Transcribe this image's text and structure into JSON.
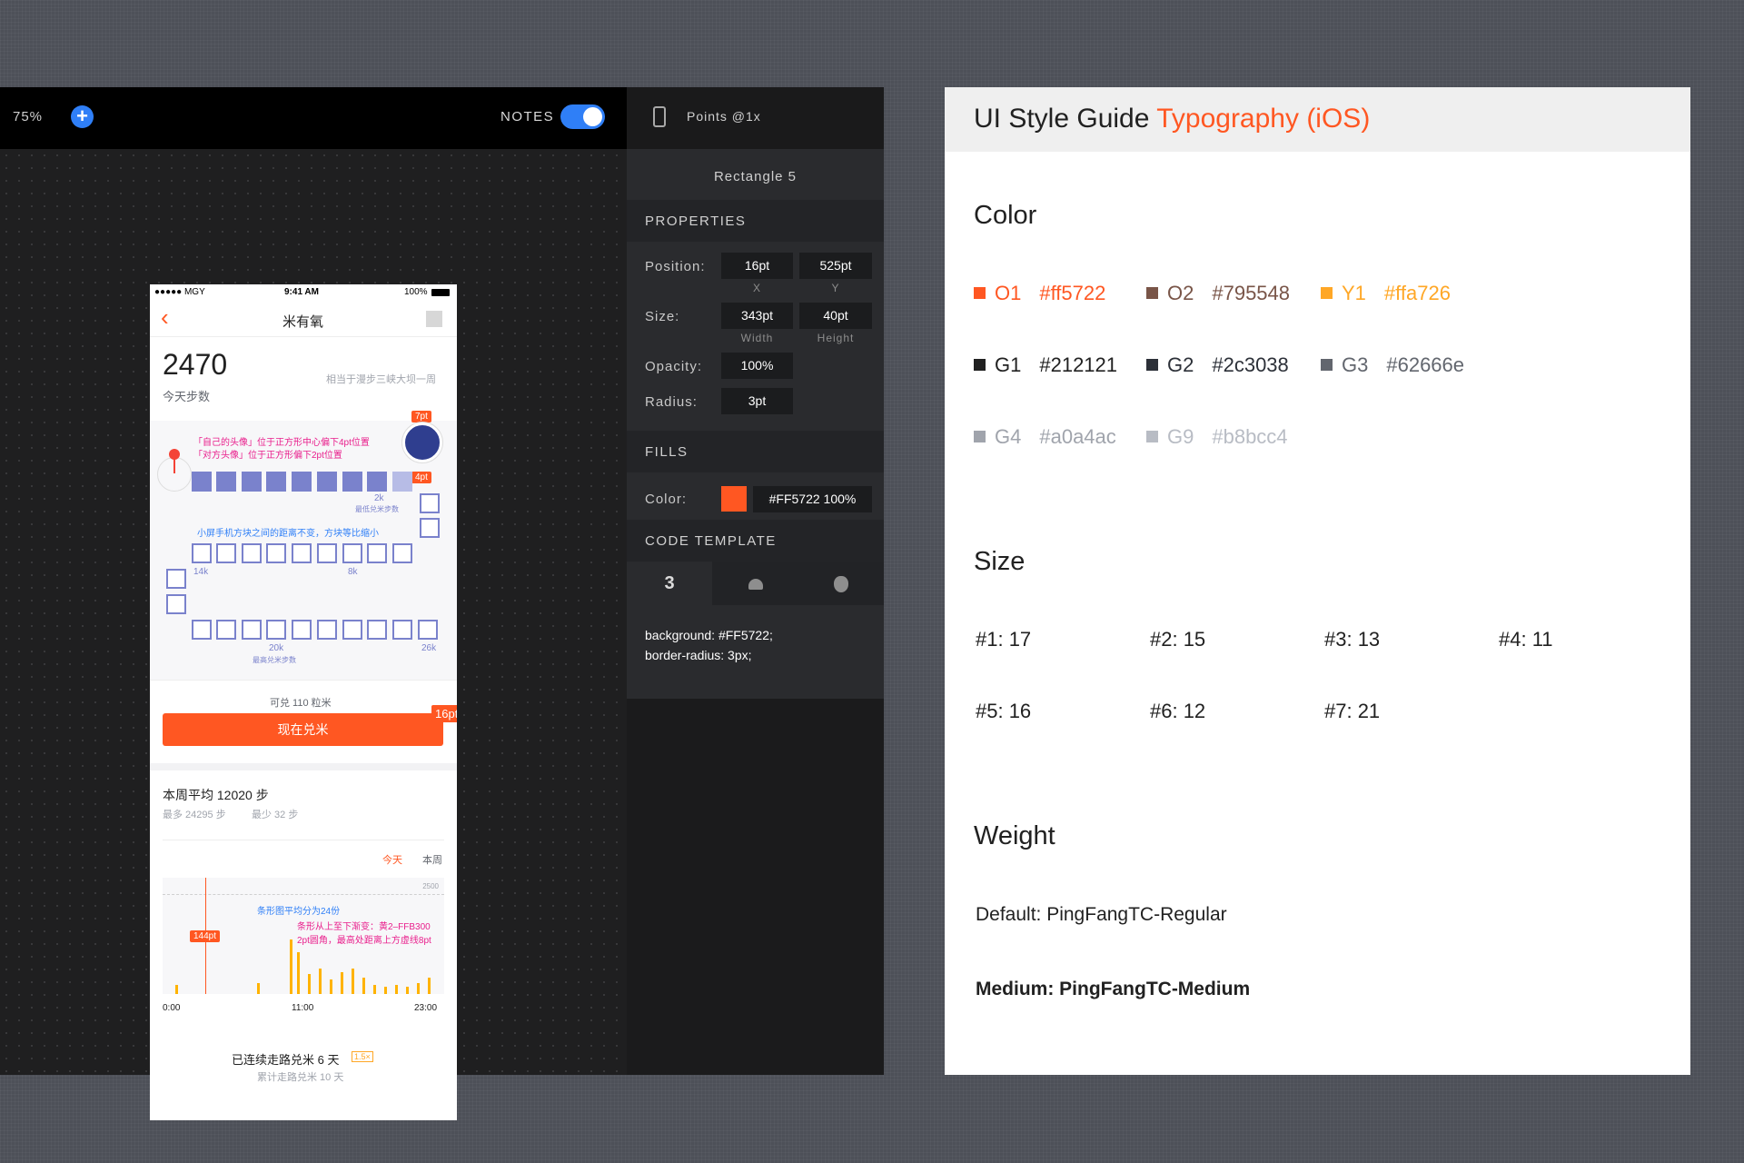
{
  "toolbar": {
    "zoom": "75%",
    "add_label": "+",
    "notes_label": "NOTES",
    "notes_on": true
  },
  "inspector": {
    "device_label": "Points @1x",
    "layer_name": "Rectangle 5",
    "properties_header": "PROPERTIES",
    "position_label": "Position:",
    "position_x": "16pt",
    "position_x_sub": "X",
    "position_y": "525pt",
    "position_y_sub": "Y",
    "size_label": "Size:",
    "size_w": "343pt",
    "size_w_sub": "Width",
    "size_h": "40pt",
    "size_h_sub": "Height",
    "opacity_label": "Opacity:",
    "opacity": "100%",
    "radius_label": "Radius:",
    "radius": "3pt",
    "fills_header": "FILLS",
    "color_label": "Color:",
    "color_value": "#FF5722 100%",
    "color_hex": "#ff5722",
    "code_header": "CODE TEMPLATE",
    "code_tabs": [
      {
        "name": "css3-icon",
        "glyph": "3"
      },
      {
        "name": "android-icon",
        "glyph": "●"
      },
      {
        "name": "apple-icon",
        "glyph": "●"
      }
    ],
    "code": "background: #FF5722;\nborder-radius: 3px;"
  },
  "phone": {
    "status_carrier": "●●●●● MGY",
    "status_time": "9:41 AM",
    "status_battery": "100%",
    "back_icon": "‹",
    "title": "米有氧",
    "steps": "2470",
    "steps_label": "今天步数",
    "equiv_text": "相当于漫步三峡大坝一周",
    "note1": "「自己的头像」位于正方形中心偏下4pt位置",
    "note2": "「对方头像」位于正方形偏下2pt位置",
    "tag_7pt": "7pt",
    "tag_4pt": "4pt",
    "label_2k": "2k",
    "label_2k_sub": "最低兑米步数",
    "note3": "小屏手机方块之间的距离不变，方块等比缩小",
    "label_14k": "14k",
    "label_8k": "8k",
    "label_20k": "20k",
    "label_20k_sub": "最高兑米步数",
    "label_26k": "26k",
    "redeem_text": "可兑 110 粒米",
    "redeem_button": "现在兑米",
    "tag_16pt": "16pt",
    "week_avg": "本周平均 12020 步",
    "week_max": "最多 24295 步",
    "week_min": "最少 32 步",
    "tab_today": "今天",
    "tab_week": "本周",
    "chart_max_label": "2500",
    "chart_note1": "条形图平均分为24份",
    "chart_note2": "条形从上至下渐变：黄2–FFB300",
    "chart_note3": "2pt圆角，最高处距离上方虚线8pt",
    "tag_144pt": "144pt",
    "x_start": "0:00",
    "x_mid": "11:00",
    "x_end": "23:00",
    "streak_text": "已连续走路兑米 6 天",
    "streak_badge": "1.5×",
    "total_text": "累计走路兑米 10 天"
  },
  "guide": {
    "title_plain": "UI Style Guide ",
    "title_accent": "Typography (iOS)",
    "accent_color": "#ff5722",
    "color_header": "Color",
    "colors": [
      {
        "name": "O1",
        "hex": "#ff5722"
      },
      {
        "name": "O2",
        "hex": "#795548"
      },
      {
        "name": "Y1",
        "hex": "#ffa726"
      },
      {
        "name": "G1",
        "hex": "#212121"
      },
      {
        "name": "G2",
        "hex": "#2c3038"
      },
      {
        "name": "G3",
        "hex": "#62666e"
      },
      {
        "name": "G4",
        "hex": "#a0a4ac"
      },
      {
        "name": "G9",
        "hex": "#b8bcc4"
      }
    ],
    "size_header": "Size",
    "sizes": [
      "#1: 17",
      "#2: 15",
      "#3: 13",
      "#4: 11",
      "#5: 16",
      "#6: 12",
      "#7: 21"
    ],
    "weight_header": "Weight",
    "weight_default": "Default: PingFangTC-Regular",
    "weight_medium": "Medium: PingFangTC-Medium"
  }
}
